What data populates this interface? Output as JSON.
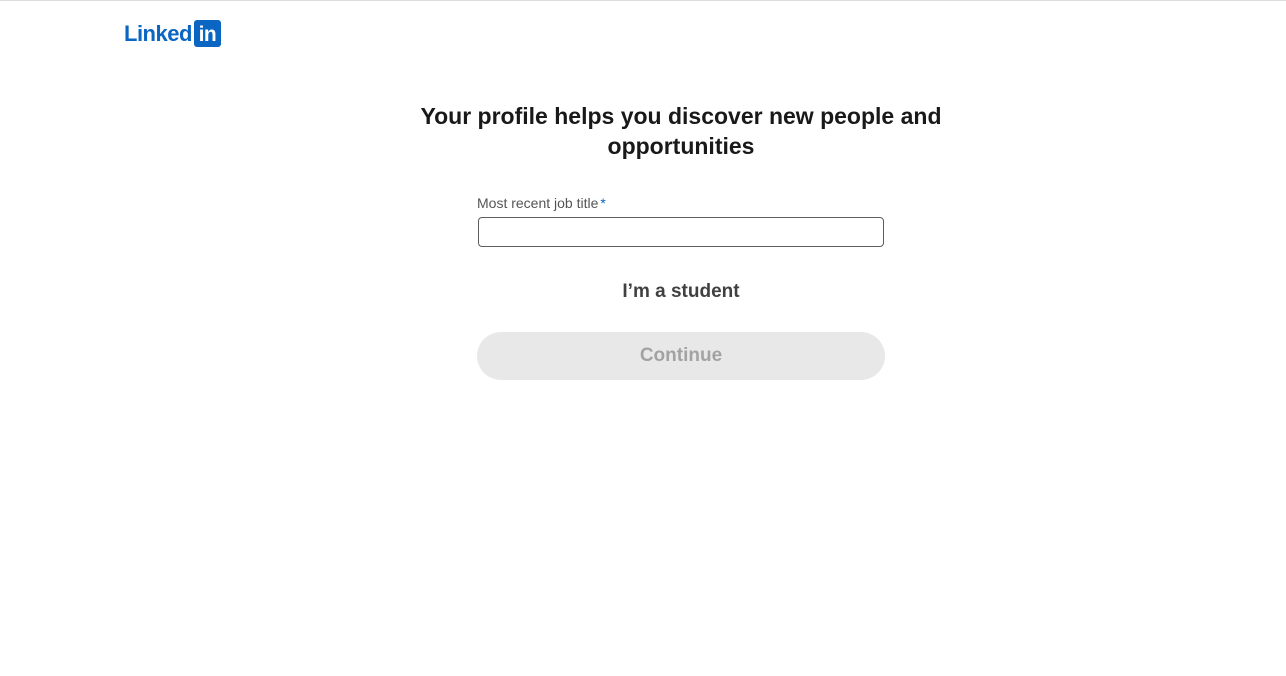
{
  "brand": {
    "logo_text": "Linked",
    "logo_box_text": "in",
    "accent_color": "#0a66c2"
  },
  "main": {
    "headline": "Your profile helps you discover new people and opportunities",
    "job_title_field": {
      "label": "Most recent job title",
      "required_marker": "*",
      "value": "",
      "placeholder": ""
    },
    "student_link": "I’m a student",
    "continue_label": "Continue",
    "continue_state": "disabled"
  }
}
